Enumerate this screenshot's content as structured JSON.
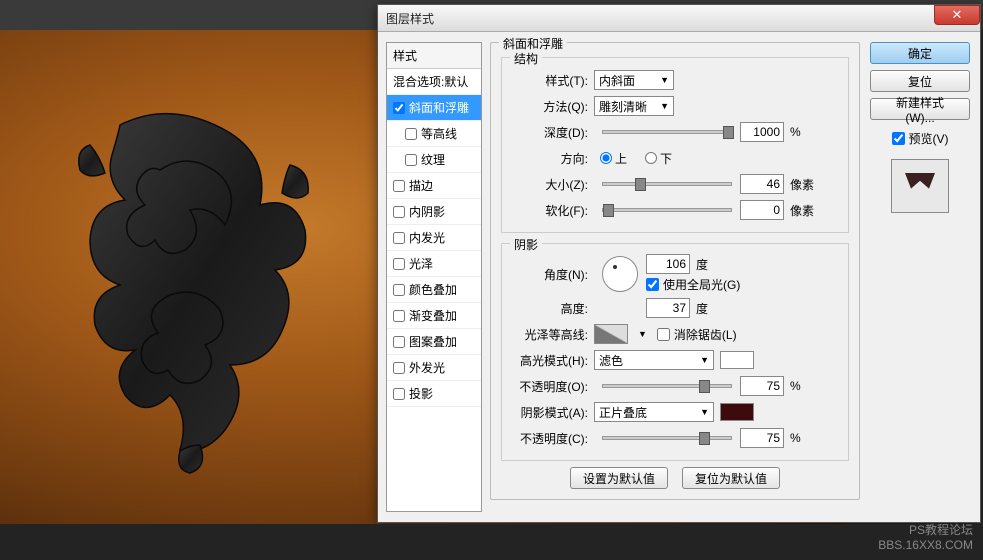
{
  "dialog_title": "图层样式",
  "close_glyph": "✕",
  "styles_header": "样式",
  "blend_options": "混合选项:默认",
  "style_items": [
    {
      "label": "斜面和浮雕",
      "checked": true,
      "selected": true
    },
    {
      "label": "等高线",
      "checked": false,
      "sub": true
    },
    {
      "label": "纹理",
      "checked": false,
      "sub": true
    },
    {
      "label": "描边",
      "checked": false
    },
    {
      "label": "内阴影",
      "checked": false
    },
    {
      "label": "内发光",
      "checked": false
    },
    {
      "label": "光泽",
      "checked": false
    },
    {
      "label": "颜色叠加",
      "checked": false
    },
    {
      "label": "渐变叠加",
      "checked": false
    },
    {
      "label": "图案叠加",
      "checked": false
    },
    {
      "label": "外发光",
      "checked": false
    },
    {
      "label": "投影",
      "checked": false
    }
  ],
  "panel_title": "斜面和浮雕",
  "structure": {
    "legend": "结构",
    "style_label": "样式(T):",
    "style_value": "内斜面",
    "technique_label": "方法(Q):",
    "technique_value": "雕刻清晰",
    "depth_label": "深度(D):",
    "depth_value": "1000",
    "depth_unit": "%",
    "direction_label": "方向:",
    "up": "上",
    "down": "下",
    "dir_selected": "up",
    "size_label": "大小(Z):",
    "size_value": "46",
    "size_unit": "像素",
    "soften_label": "软化(F):",
    "soften_value": "0",
    "soften_unit": "像素"
  },
  "shading": {
    "legend": "阴影",
    "angle_label": "角度(N):",
    "angle_value": "106",
    "angle_unit": "度",
    "global_light": "使用全局光(G)",
    "global_checked": true,
    "altitude_label": "高度:",
    "altitude_value": "37",
    "altitude_unit": "度",
    "gloss_contour_label": "光泽等高线:",
    "antialias": "消除锯齿(L)",
    "antialias_checked": false,
    "highlight_mode_label": "高光模式(H):",
    "highlight_mode_value": "滤色",
    "highlight_color": "#ffffff",
    "highlight_opacity_label": "不透明度(O):",
    "highlight_opacity_value": "75",
    "opacity_unit": "%",
    "shadow_mode_label": "阴影模式(A):",
    "shadow_mode_value": "正片叠底",
    "shadow_color": "#3d0b0b",
    "shadow_opacity_label": "不透明度(C):",
    "shadow_opacity_value": "75"
  },
  "set_default": "设置为默认值",
  "reset_default": "复位为默认值",
  "buttons": {
    "ok": "确定",
    "cancel": "复位",
    "new_style": "新建样式(W)...",
    "preview": "预览(V)"
  },
  "preview_checked": true,
  "watermark": {
    "l1": "PS教程论坛",
    "l2": "BBS.16XX8.COM"
  }
}
